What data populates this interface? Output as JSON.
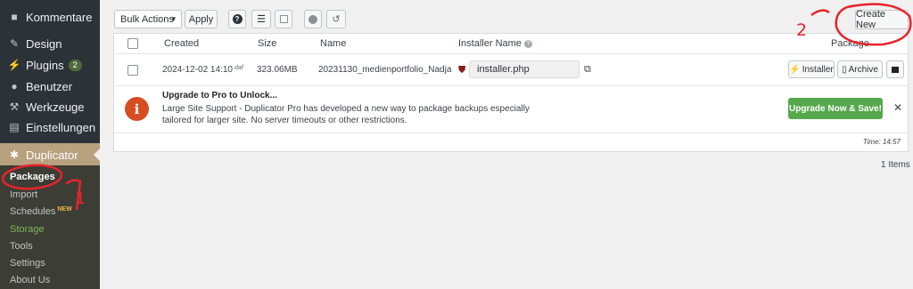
{
  "sidebar": {
    "items": [
      {
        "label": "Kommentare",
        "icon": "comment-icon"
      },
      {
        "label": "Design",
        "icon": "brush-icon"
      },
      {
        "label": "Plugins",
        "icon": "plugin-icon",
        "badge": "2"
      },
      {
        "label": "Benutzer",
        "icon": "user-icon"
      },
      {
        "label": "Werkzeuge",
        "icon": "wrench-icon"
      },
      {
        "label": "Einstellungen",
        "icon": "settings-icon"
      }
    ],
    "active": {
      "label": "Duplicator",
      "icon": "duplicator-icon"
    },
    "submenu": {
      "packages": "Packages",
      "import": "Import",
      "schedules": "Schedules",
      "schedules_tag": "NEW",
      "storage": "Storage",
      "tools": "Tools",
      "settings": "Settings",
      "about": "About Us"
    }
  },
  "toolbar": {
    "bulk_actions": "Bulk Actions",
    "apply": "Apply",
    "create_new": "Create New"
  },
  "table": {
    "headers": {
      "created": "Created",
      "size": "Size",
      "name": "Name",
      "installer_name": "Installer Name",
      "package": "Package"
    },
    "row": {
      "created": "2024-12-02 14:10",
      "created_suffix": "daf",
      "size": "323.06MB",
      "name": "20231130_medienportfolio_Nadja",
      "installer": "installer.php",
      "installer_btn": "Installer",
      "archive_btn": "Archive"
    }
  },
  "notice": {
    "title": "Upgrade to Pro to Unlock...",
    "text": "Large Site Support - Duplicator Pro has developed a new way to package backups especially tailored for larger site. No server timeouts or other restrictions.",
    "button": "Upgrade Now & Save!"
  },
  "time": "Time: 14:57",
  "items_count": "1 Items",
  "annotations": {
    "one": "1",
    "two": "2"
  },
  "colors": {
    "sidebar": "#2c3338",
    "active": "#b8a17e",
    "upgrade": "#56a84c",
    "info": "#d54e21",
    "annotation": "#e8232a"
  }
}
